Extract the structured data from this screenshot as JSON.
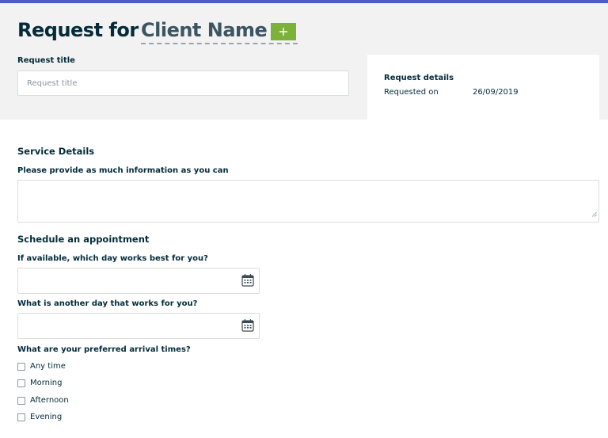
{
  "header": {
    "title_prefix": "Request for",
    "client_name": "Client Name",
    "add_client_icon": "plus-icon"
  },
  "request_title": {
    "label": "Request title",
    "placeholder": "Request title",
    "value": ""
  },
  "request_details": {
    "title": "Request details",
    "requested_on_label": "Requested on",
    "requested_on_value": "26/09/2019"
  },
  "service_details": {
    "heading": "Service Details",
    "info_label": "Please provide as much information as you can",
    "info_value": ""
  },
  "schedule": {
    "heading": "Schedule an appointment",
    "first_day_label": "If available, which day works best for you?",
    "first_day_value": "",
    "second_day_label": "What is another day that works for you?",
    "second_day_value": "",
    "calendar_icon": "calendar-icon",
    "arrival_label": "What are your preferred arrival times?",
    "arrival_options": [
      {
        "label": "Any time",
        "checked": false
      },
      {
        "label": "Morning",
        "checked": false
      },
      {
        "label": "Afternoon",
        "checked": false
      },
      {
        "label": "Evening",
        "checked": false
      }
    ]
  },
  "colors": {
    "accent_bar": "#4a5bc4",
    "add_button": "#7db23a",
    "text_dark": "#032b3a",
    "header_bg": "#f2f2f2"
  }
}
